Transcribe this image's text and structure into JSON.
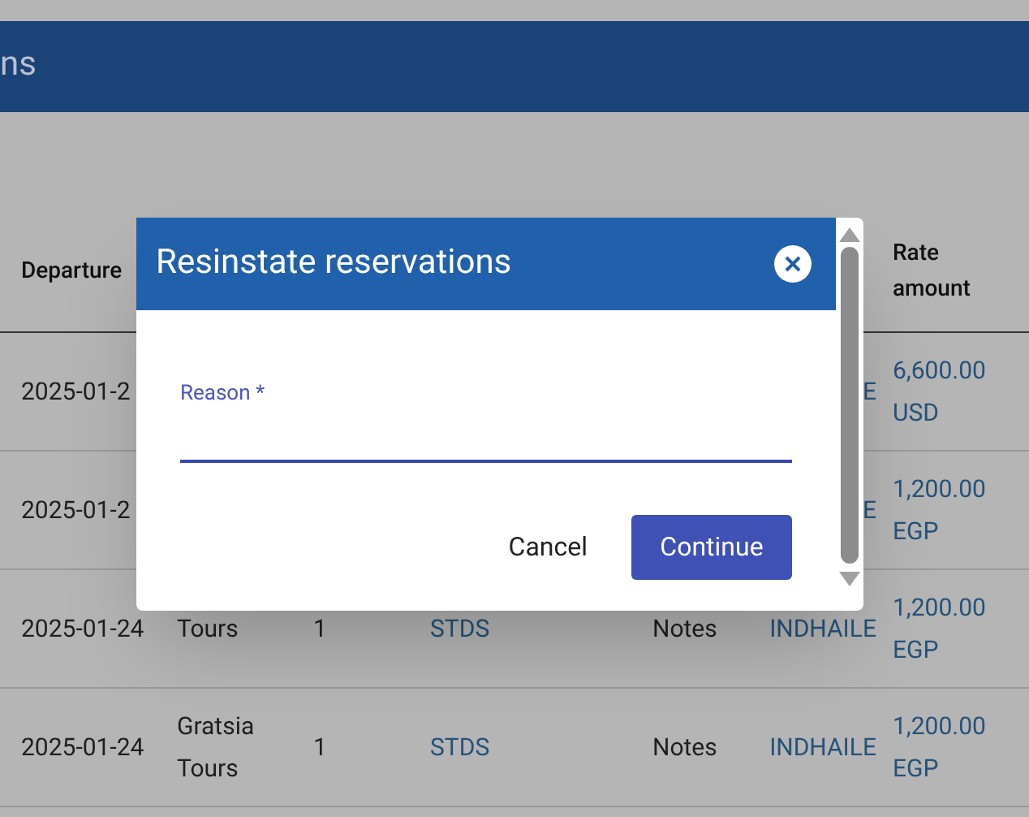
{
  "page_header": {
    "title": "ns"
  },
  "table": {
    "columns": {
      "departure": "Departure",
      "rate_amount": "Rate amount"
    },
    "rows": [
      {
        "departure": "2025-01-2",
        "column_7": "E",
        "rate_amount": "6,600.00 USD"
      },
      {
        "departure": "2025-01-2",
        "column_7": "E",
        "rate_amount": "1,200.00 EGP"
      },
      {
        "departure": "2025-01-24",
        "column_3": "Tours",
        "column_4": "1",
        "column_5": "STDS",
        "column_6": "Notes",
        "column_7": "INDHAILE",
        "rate_amount": "1,200.00 EGP"
      },
      {
        "departure": "2025-01-24",
        "column_3": "Gratsia Tours",
        "column_4": "1",
        "column_5": "STDS",
        "column_6": "Notes",
        "column_7": "INDHAILE",
        "rate_amount": "1,200.00 EGP"
      }
    ]
  },
  "dialog": {
    "title": "Resinstate reservations",
    "field": {
      "label": "Reason *"
    },
    "buttons": [
      {
        "kind": "text",
        "label": "Cancel"
      },
      {
        "kind": "primary",
        "label": "Continue"
      }
    ]
  }
}
